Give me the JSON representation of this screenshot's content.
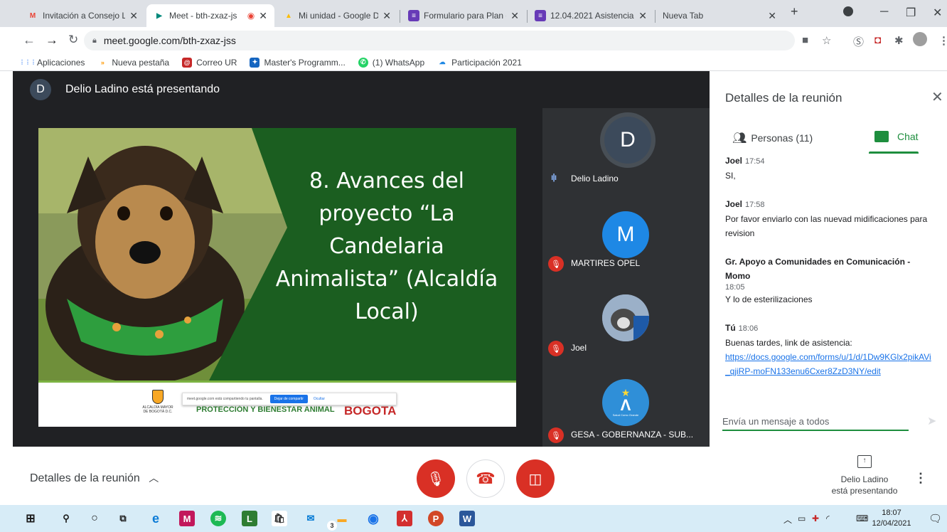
{
  "browser": {
    "tabs": [
      {
        "title": "Invitación a Consejo L",
        "icon_color": "#ea4335",
        "icon_glyph": "M"
      },
      {
        "title": "Meet - bth-zxaz-js",
        "icon_color": "#00897b",
        "icon_glyph": "▶"
      },
      {
        "title": "Mi unidad - Google D",
        "icon_color": "#fbbc04",
        "icon_glyph": "▲"
      },
      {
        "title": "Formulario para Plan d",
        "icon_color": "#673ab7",
        "icon_glyph": "≡"
      },
      {
        "title": "12.04.2021 Asistencia",
        "icon_color": "#673ab7",
        "icon_glyph": "≡"
      },
      {
        "title": "Nueva Tab",
        "icon_color": "",
        "icon_glyph": ""
      }
    ],
    "new_tab": "+",
    "url": "meet.google.com/bth-zxaz-jss"
  },
  "bookmarks": [
    {
      "label": "Aplicaciones",
      "color": "#4285f4",
      "glyph": "⋮⋮⋮"
    },
    {
      "label": "Nueva pestaña",
      "color": "#ff9800",
      "glyph": "»"
    },
    {
      "label": "Correo UR",
      "color": "#c62828",
      "glyph": "@"
    },
    {
      "label": "Master's Programm...",
      "color": "#1565c0",
      "glyph": "✦"
    },
    {
      "label": "(1) WhatsApp",
      "color": "#25d366",
      "glyph": "✆"
    },
    {
      "label": "Participación 2021",
      "color": "#1e88e5",
      "glyph": "☁"
    }
  ],
  "meet": {
    "presenter_initial": "D",
    "presenter_banner": "Delio Ladino está presentando",
    "slide": {
      "title": "8. Avances del proyecto “La Candelaria Animalista” (Alcaldía Local)",
      "footer_escudo": "ALCALDÍA MAYOR DE BOGOTÁ D.C.",
      "footer_program": "PROTECCIÓN Y BIENESTAR ANIMAL",
      "footer_city": "BOGOTA",
      "share_notice": "meet.google.com está compartiendo tu pantalla.",
      "share_stop": "Dejar de compartir",
      "share_hide": "Ocultar"
    },
    "participants": [
      {
        "initial": "D",
        "name": "Delio Ladino",
        "color": "#3c4a5b",
        "muted": false
      },
      {
        "initial": "M",
        "name": "MARTIRES OPEL",
        "color": "#1e88e5",
        "muted": true
      },
      {
        "initial": "",
        "name": "Joel",
        "color": "#7b8da6",
        "muted": true
      },
      {
        "initial": "",
        "name": "GESA - GOBERNANZA - SUB...",
        "color": "#2f8fd8",
        "muted": true,
        "avatar_caption": "Salud Como Grande"
      }
    ]
  },
  "panel": {
    "title": "Detalles de la reunión",
    "tab_people": "Personas (11)",
    "tab_chat": "Chat",
    "messages": [
      {
        "sender": "Joel",
        "time": "17:54",
        "text": "SI,"
      },
      {
        "sender": "Joel",
        "time": "17:58",
        "text": "Por favor enviarlo con las nuevad midificaciones para revision"
      },
      {
        "sender": "Gr. Apoyo a Comunidades en Comunicación - Momo",
        "time": "18:05",
        "text": "Y lo de esterilizaciones"
      },
      {
        "sender": "Tú",
        "time": "18:06",
        "text": "Buenas tardes, link de asistencia:",
        "link": "https://docs.google.com/forms/u/1/d/1Dw9KGlx2pikAVi_qjiRP-moFN133enu6Cxer8ZzD3NY/edit"
      }
    ],
    "input_placeholder": "Envía un mensaje a todos"
  },
  "controls": {
    "meeting_details": "Detalles de la reunión",
    "present_line1": "Delio Ladino",
    "present_line2": "está presentando"
  },
  "taskbar": {
    "time": "18:07",
    "date": "12/04/2021",
    "badge_count": "3"
  }
}
